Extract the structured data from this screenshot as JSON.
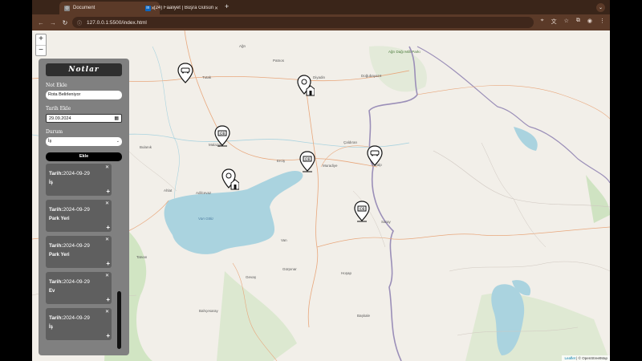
{
  "browser": {
    "tabs": [
      {
        "title": "Document",
        "favicon": "globe-icon"
      },
      {
        "title": "(24) Faaliyet | Büşra Gülsün",
        "favicon": "linkedin-icon"
      }
    ],
    "url": "127.0.0.1:5500/index.html"
  },
  "map": {
    "zoom_in": "+",
    "zoom_out": "−",
    "places": [
      "Ağrı",
      "Tutak",
      "Diyadin",
      "Doğubayazıt",
      "Patnos",
      "Tekman",
      "Hınıs",
      "Malazgirt",
      "Erciş",
      "Bulanık",
      "Ahlat",
      "Adilcevaz",
      "Muradiye",
      "Çaldıran",
      "Özalp",
      "Saray",
      "Van",
      "Gürpınar",
      "Gevaş",
      "Tatvan",
      "Van Gölü",
      "Bahçesaray",
      "Başkale",
      "Hoşap",
      "Ağrı Dağı Milli Parkı"
    ],
    "markers": [
      "parking-marker",
      "home-marker",
      "work-marker",
      "work-marker",
      "parking-marker",
      "home-marker",
      "work-marker"
    ],
    "attribution_leaflet": "Leaflet",
    "attribution_osm": "| © OpenStreetMap"
  },
  "panel": {
    "title": "Notlar",
    "note_label": "Not Ekle",
    "note_value": "Rota Belirleniyor",
    "date_label": "Tarih Ekle",
    "date_value": "29.09.2024",
    "status_label": "Durum",
    "status_value": "İş",
    "add_button": "Ekle",
    "date_prefix": "Tarih:",
    "notes": [
      {
        "date": "2024-09-29",
        "status": "İş"
      },
      {
        "date": "2024-09-29",
        "status": "Park Yeri"
      },
      {
        "date": "2024-09-29",
        "status": "Park Yeri"
      },
      {
        "date": "2024-09-29",
        "status": "Ev"
      },
      {
        "date": "2024-09-29",
        "status": "İş"
      }
    ]
  }
}
